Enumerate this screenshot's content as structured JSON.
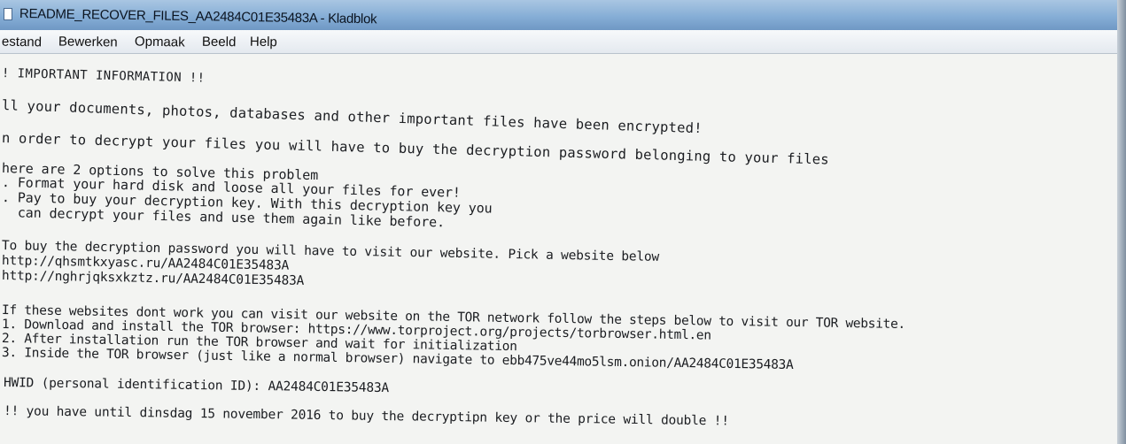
{
  "window": {
    "title": "README_RECOVER_FILES_AA2484C01E35483A - Kladblok"
  },
  "menu": [
    "estand",
    "Bewerken",
    "Opmaak",
    "Beeld",
    "Help"
  ],
  "document": {
    "lines": [
      "! IMPORTANT INFORMATION !!",
      "ll your documents, photos, databases and other important files have been encrypted!",
      "n order to decrypt your files you will have to buy the decryption password belonging to your files",
      "here are 2 options to solve this problem",
      ". Format your hard disk and loose all your files for ever!",
      ". Pay to buy your decryption key. With this decryption key you",
      "  can decrypt your files and use them again like before.",
      "To buy the decryption password you will have to visit our website. Pick a website below",
      "http://qhsmtkxyasc.ru/AA2484C01E35483A",
      "http://nghrjqksxkztz.ru/AA2484C01E35483A",
      "If these websites dont work you can visit our website on the TOR network follow the steps below to visit our TOR website.",
      "1. Download and install the TOR browser: https://www.torproject.org/projects/torbrowser.html.en",
      "2. After installation run the TOR browser and wait for initialization",
      "3. Inside the TOR browser (just like a normal browser) navigate to ebb475ve44mo5lsm.onion/AA2484C01E35483A",
      "HWID (personal identification ID): AA2484C01E35483A",
      "!! you have until dinsdag 15 november 2016 to buy the decryptipn key or the price will double !!"
    ]
  }
}
